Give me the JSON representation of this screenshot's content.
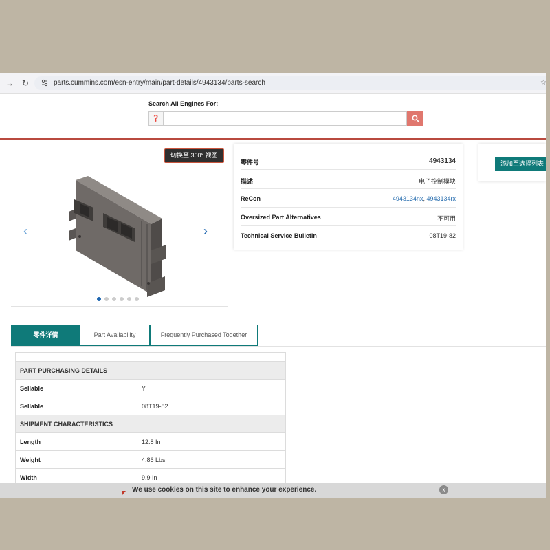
{
  "browser": {
    "url": "parts.cummins.com/esn-entry/main/part-details/4943134/parts-search",
    "back_glyph": "→",
    "reload_glyph": "↻",
    "star_glyph": "☆"
  },
  "search": {
    "label": "Search All Engines For:",
    "help_glyph": "❓",
    "value": "",
    "placeholder": ""
  },
  "product": {
    "view360_label": "切换至 360° 视图",
    "prev_glyph": "‹",
    "next_glyph": "›",
    "carousel_count": 6,
    "carousel_active": 0
  },
  "details": {
    "rows": [
      {
        "label": "零件号",
        "value": "4943134"
      },
      {
        "label": "描述",
        "value": "电子控制模块"
      },
      {
        "label": "ReCon",
        "link1": "4943134nx",
        "sep": ", ",
        "link2": "4943134rx"
      },
      {
        "label": "Oversized Part Alternatives",
        "value": "不可用"
      },
      {
        "label": "Technical Service Bulletin",
        "value": "08T19-82"
      }
    ]
  },
  "add_to_list": {
    "label": "添加至选择列表 +"
  },
  "tabs": [
    {
      "label": "零件详情",
      "active": true
    },
    {
      "label": "Part Availability",
      "active": false
    },
    {
      "label": "Frequently Purchased Together",
      "active": false
    }
  ],
  "table": {
    "section1": "PART PURCHASING DETAILS",
    "rows1": [
      {
        "label": "Sellable",
        "value": "Y"
      },
      {
        "label": "Sellable",
        "value": "08T19-82"
      }
    ],
    "section2": "SHIPMENT CHARACTERISTICS",
    "rows2": [
      {
        "label": "Length",
        "value": "12.8 In"
      },
      {
        "label": "Weight",
        "value": "4.86 Lbs"
      },
      {
        "label": "Width",
        "value": "9.9 In"
      }
    ]
  },
  "cookie": {
    "text": "We use cookies on this site to enhance your experience.",
    "close_glyph": "x"
  },
  "colors": {
    "teal": "#0f7a79",
    "search_button": "#e0776e",
    "divider": "#b94a3f",
    "link": "#2a6fb0"
  }
}
